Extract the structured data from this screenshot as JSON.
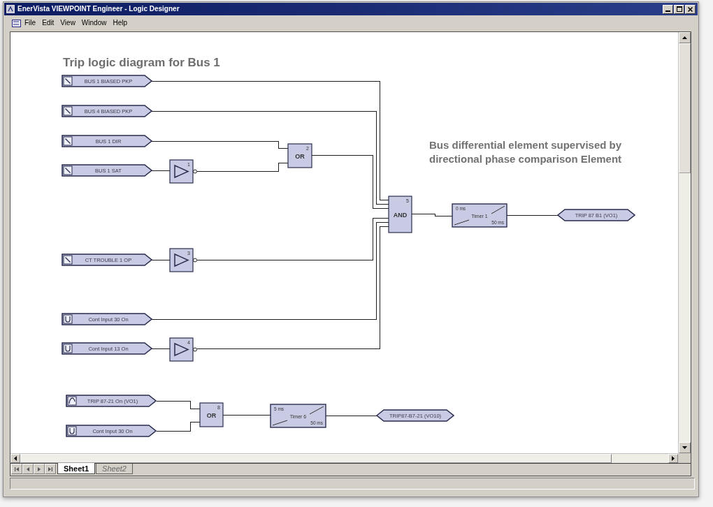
{
  "window": {
    "title": "EnerVista VIEWPOINT Engineer - Logic Designer"
  },
  "menu": [
    "File",
    "Edit",
    "View",
    "Window",
    "Help"
  ],
  "diagram": {
    "annotations": [
      {
        "text": "Trip logic diagram for Bus 1"
      },
      {
        "text": "Bus differential element supervised by directional phase comparison Element"
      }
    ],
    "inputs": [
      {
        "label": "BUS 1 BIASED PKP",
        "kind": "operand"
      },
      {
        "label": "BUS 4 BIASED PKP",
        "kind": "operand"
      },
      {
        "label": "BUS 1 DIR",
        "kind": "operand"
      },
      {
        "label": "BUS 1 SAT",
        "kind": "operand"
      },
      {
        "label": "CT TROUBLE 1 OP",
        "kind": "operand"
      },
      {
        "label": "Cont Input 30 On",
        "kind": "contact"
      },
      {
        "label": "Cont Input 13 On",
        "kind": "contact"
      },
      {
        "label": "TRIP 87-21 On (VO1)",
        "kind": "virtual"
      },
      {
        "label": "Cont Input 30 On",
        "kind": "contact"
      }
    ],
    "gates": [
      {
        "kind": "or",
        "label": "OR",
        "number": "2"
      },
      {
        "kind": "not",
        "number": "1"
      },
      {
        "kind": "not",
        "number": "3"
      },
      {
        "kind": "not",
        "number": "4"
      },
      {
        "kind": "and",
        "label": "AND",
        "number": "5"
      },
      {
        "kind": "or",
        "label": "OR",
        "number": "8"
      }
    ],
    "timers": [
      {
        "name": "Timer 1",
        "pickup": "0 ms",
        "dropout": "50 ms"
      },
      {
        "name": "Timer 6",
        "pickup": "5 ms",
        "dropout": "50 ms"
      }
    ],
    "outputs": [
      {
        "label": "TRIP 87 B1 (VO1)"
      },
      {
        "label": "TRIP87-B7-21 (VO10)"
      }
    ]
  },
  "sheet_tabs": [
    {
      "label": "Sheet1",
      "selected": true
    },
    {
      "label": "Sheet2",
      "selected": false
    }
  ]
}
